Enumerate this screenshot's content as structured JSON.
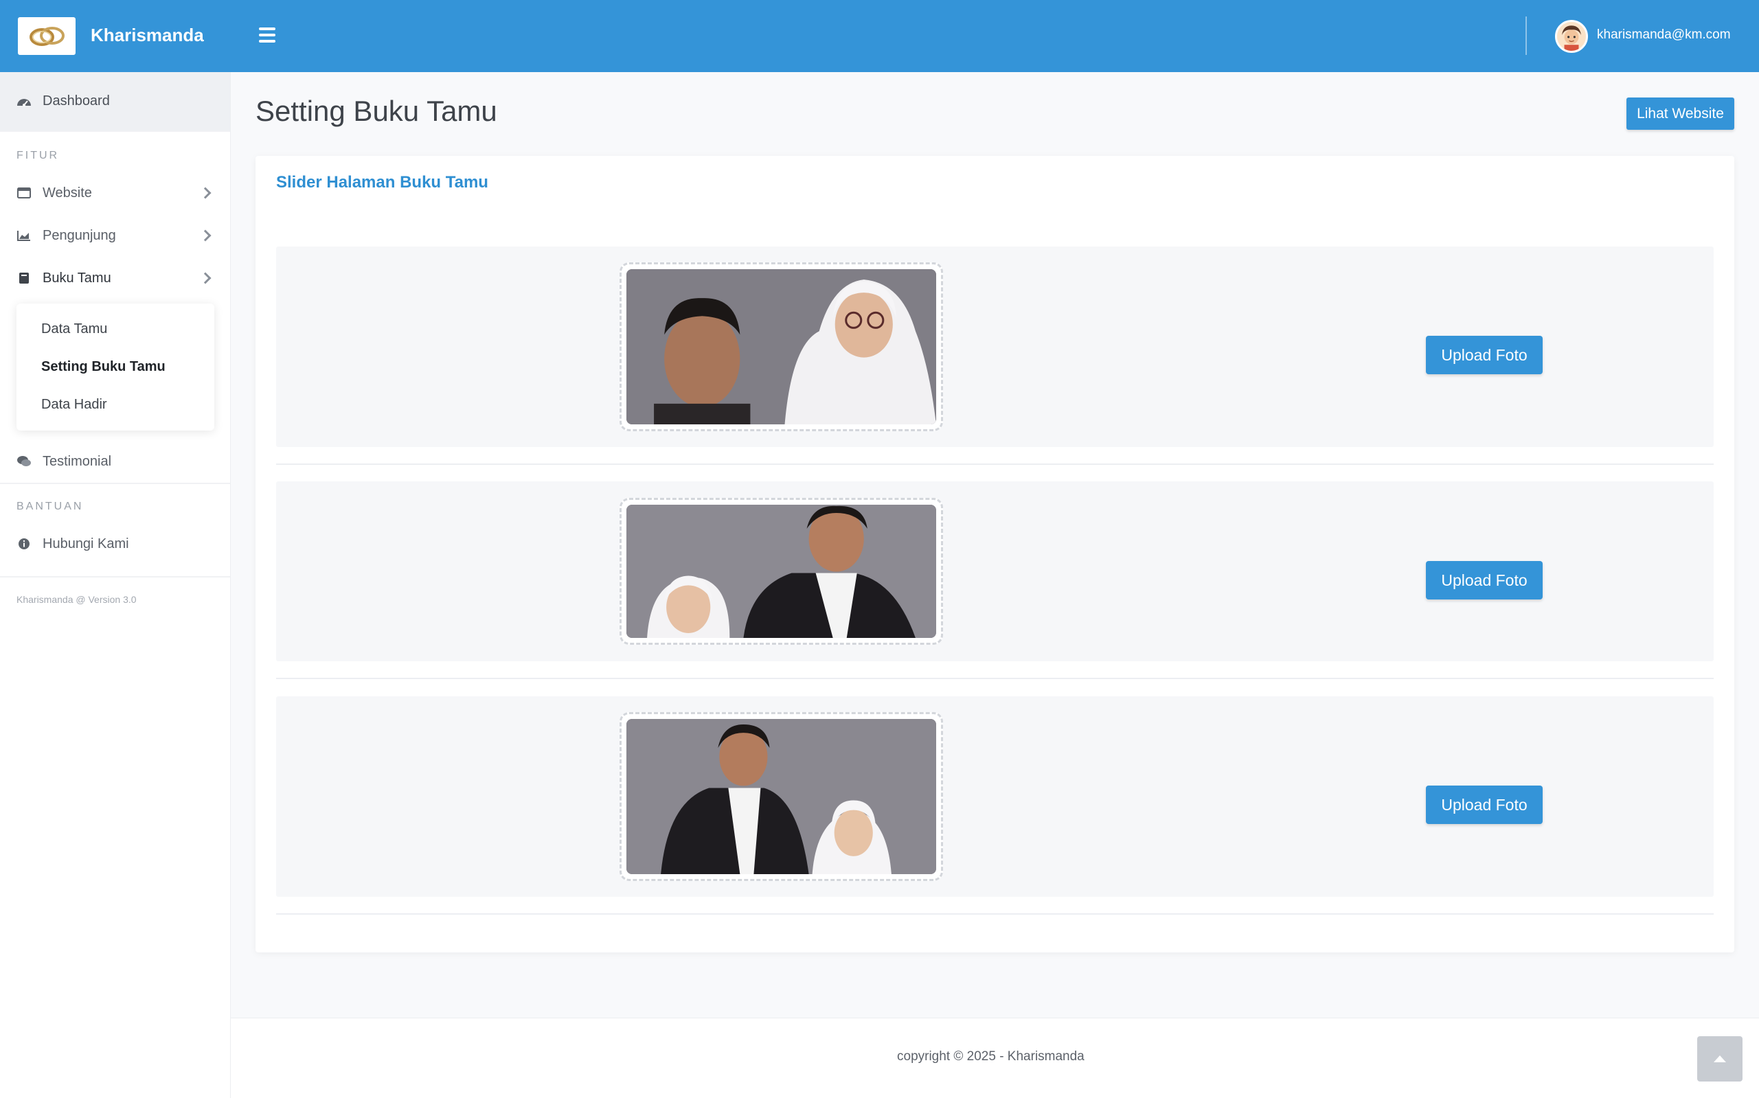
{
  "app": {
    "brand": "Kharismanda",
    "accent": "#3494d8"
  },
  "header": {
    "user_email": "kharismanda@km.com"
  },
  "sidebar": {
    "dashboard": "Dashboard",
    "section_fitur": "FITUR",
    "items": [
      {
        "label": "Website",
        "icon": "window-icon"
      },
      {
        "label": "Pengunjung",
        "icon": "area-chart-icon"
      },
      {
        "label": "Buku Tamu",
        "icon": "book-icon"
      }
    ],
    "submenu": [
      "Data Tamu",
      "Setting Buku Tamu",
      "Data Hadir"
    ],
    "testimonial": "Testimonial",
    "section_bantuan": "BANTUAN",
    "contact": "Hubungi Kami",
    "version": "Kharismanda @ Version 3.0"
  },
  "main": {
    "title": "Setting Buku Tamu",
    "view_site": "Lihat Website",
    "card_title": "Slider Halaman Buku Tamu",
    "slides": [
      {
        "upload_label": "Upload Foto"
      },
      {
        "upload_label": "Upload Foto"
      },
      {
        "upload_label": "Upload Foto"
      }
    ]
  },
  "footer": {
    "copyright": "copyright © 2025 - Kharismanda"
  }
}
